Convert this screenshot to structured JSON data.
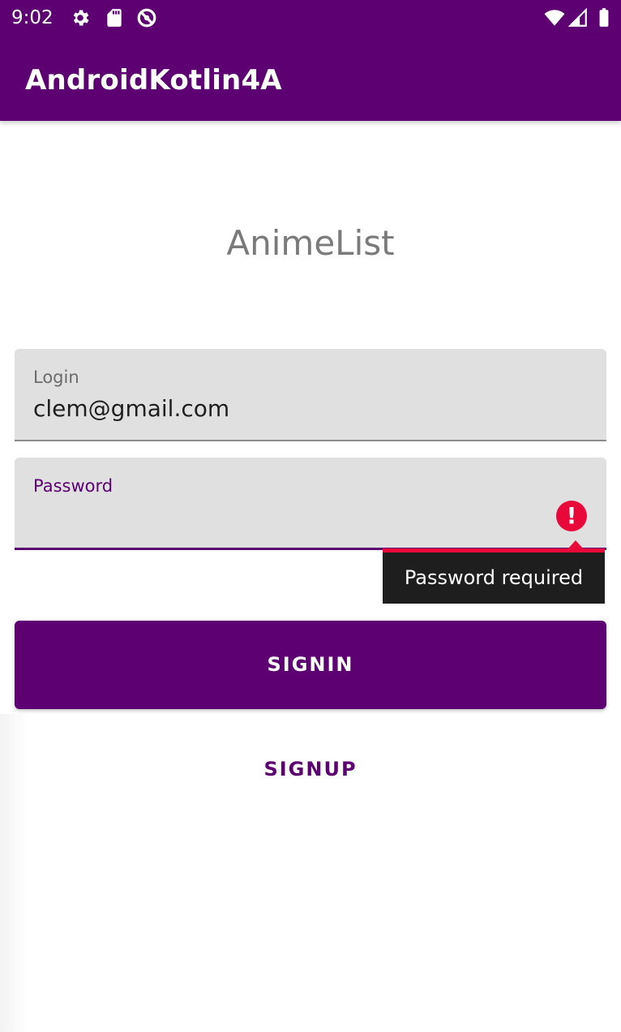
{
  "status_bar": {
    "time": "9:02",
    "icons": [
      "settings-icon",
      "sd-card-icon",
      "no-disturb-icon",
      "wifi-icon",
      "signal-icon",
      "battery-icon"
    ]
  },
  "app_bar": {
    "title": "AndroidKotlin4A"
  },
  "screen": {
    "heading": "AnimeList"
  },
  "login_field": {
    "label": "Login",
    "value": "clem@gmail.com"
  },
  "password_field": {
    "label": "Password",
    "value": "",
    "error_icon": "!",
    "error": "Password required"
  },
  "buttons": {
    "signin": "SIGNIN",
    "signup": "SIGNUP"
  },
  "colors": {
    "primary": "#5c0072",
    "error": "#e8093a",
    "field_bg": "#e0e0e0"
  }
}
